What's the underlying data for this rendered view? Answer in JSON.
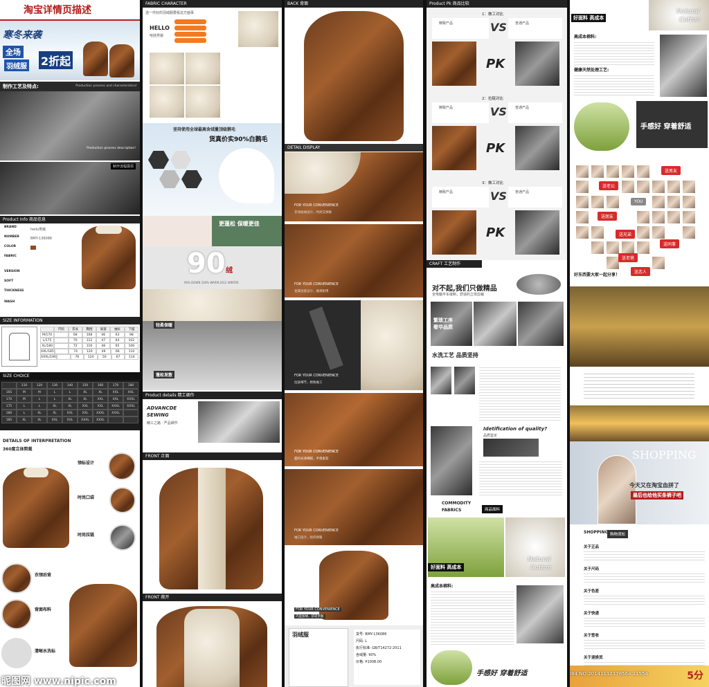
{
  "col1": {
    "header": "淘宝详情页描述",
    "banner_top": "寒冬来袭",
    "banner_mid": "全场",
    "banner_sub": "羽绒服",
    "banner_price": "2折起",
    "process_cn": "制作工艺及特点:",
    "process_en": "Production process and characteristics!",
    "process_note": "Production process description!",
    "flow_label": "制作流程展现",
    "product_info": "Product Info",
    "product_info_cn": "商品信息",
    "attr_brand": "BRAND",
    "attr_number": "NUMBER",
    "attr_color": "COLOR",
    "attr_fabric": "FABRIC",
    "attr_version": "VERSION",
    "attr_soft": "SOFT",
    "attr_thickness": "THICKNESS",
    "attr_wash": "WASH",
    "val_brand": "hello男装",
    "val_number": "BMY-136086",
    "size_info": "SIZE INFORMATION",
    "size_choice": "SIZE CHOICE",
    "size_headers": [
      "",
      "尺码",
      "衣长",
      "胸围",
      "肩宽",
      "袖长",
      "下摆"
    ],
    "size_rows": [
      [
        "M/170",
        "",
        "68",
        "108",
        "46",
        "63",
        "98"
      ],
      [
        "L/175",
        "",
        "70",
        "112",
        "47",
        "64",
        "102"
      ],
      [
        "XL/180",
        "",
        "72",
        "116",
        "48",
        "65",
        "106"
      ],
      [
        "XXL/185",
        "",
        "74",
        "120",
        "49",
        "66",
        "110"
      ],
      [
        "XXXL/190",
        "",
        "76",
        "124",
        "50",
        "67",
        "114"
      ]
    ],
    "choice_headers": [
      "",
      "110",
      "120",
      "130",
      "140",
      "150",
      "160",
      "170",
      "180"
    ],
    "choice_rows": [
      [
        "165",
        "M",
        "M",
        "L",
        "L",
        "XL",
        "XL",
        "XXL",
        "XXL"
      ],
      [
        "170",
        "M",
        "L",
        "L",
        "XL",
        "XL",
        "XXL",
        "XXL",
        "XXXL"
      ],
      [
        "175",
        "L",
        "L",
        "XL",
        "XL",
        "XXL",
        "XXL",
        "XXXL",
        "XXXL"
      ],
      [
        "180",
        "L",
        "XL",
        "XL",
        "XXL",
        "XXL",
        "XXXL",
        "XXXL",
        ""
      ],
      [
        "185",
        "XL",
        "XL",
        "XXL",
        "XXL",
        "XXXL",
        "XXXL",
        "",
        ""
      ]
    ],
    "details_en": "DETAILS OF INTERPRETATION",
    "details_cn": "360度立体剪裁",
    "detail_collar": "领标设计",
    "detail_pocket": "时尚口袋",
    "detail_zip": "时尚拉链",
    "detail_back": "衣领后背",
    "detail_fabric": "背面布料",
    "detail_wash": "清晰水洗标",
    "watermark": "昵图网 www.nipic.com"
  },
  "col2": {
    "fabric_bar": "FABRIC CHARACTER",
    "fabric_cn": "选一件好的羽绒服要看这方面事",
    "hello": "HELLO",
    "hello_sub": "哈娃男装",
    "goose_title": "坚持使用全球最高含绒量顶级鹅毛",
    "goose_sub": "货真价实90%白鹅毛",
    "fluffy": "更蓬松 保暖更佳",
    "ninety": "90",
    "ninety_cn": "绒",
    "ninety_en": "90% DOWN   100% WARM   2012 WINTER",
    "light": "轻柔保暖",
    "fluff_warm": "蓬松发散",
    "details_bar": "Product details",
    "details_cn": "精工细作",
    "advance": "ADVANCDE",
    "sewing": "SEWING",
    "sewing_cn": "精工之路 · 严品细节",
    "front_bar": "FRONT",
    "front_cn": "正面",
    "front2_bar": "FRONT",
    "front2_cn": "敞开"
  },
  "col3": {
    "back_bar": "BACK",
    "back_cn": "背面",
    "detail_bar": "DETAIL DISPLAY",
    "conv": "FOR YOUR CONVENIENCE",
    "conv2": "FOR YOUR CONVENIENCE",
    "cap1": "衣领加绒设计，时尚又保暖",
    "cap2": "金属拉链设计，顺滑耐用",
    "cap3": "拉链细节，精致做工",
    "cap4": "面料光泽细腻，手感柔软",
    "cap5": "袖口设计，防风保暖",
    "cap6": "内里加绒，舒适亲肤",
    "label_title": "羽绒服",
    "label_lines": [
      "货号: BMY-136086",
      "尺码: L",
      "执行标准: GB/T14272-2011",
      "含绒量: 90%",
      "价格: ¥1008.00"
    ]
  },
  "col4": {
    "pk_bar": "Product Pk",
    "pk_cn": "商品比较",
    "cmp1": "1：做工对比",
    "cmp2": "2：拉链对比",
    "cmp3": "3：做工对比",
    "ours": "精致产品",
    "others": "普通产品",
    "vs": "VS",
    "pk": "PK",
    "craft_bar": "CRAFT",
    "craft_sub": "MANUFACTURE",
    "craft_cn": "工艺制作",
    "sorry": "对不起,我们只做精品",
    "sorry_sub": "全电脑平车缝制，舒适的立体剪裁",
    "boutique": "繁琐工序\n奢华品质",
    "wash": "水洗工艺 品质坚持",
    "ident": "Idetification of quality?",
    "ident_cn": "品质鉴定",
    "commodity": "COMMODITY",
    "fabrics": "FABRICS",
    "fabrics_cn": "商品面料",
    "good_fabric": "好面料 高成本",
    "natural": "Natural",
    "cotton": "Cotton",
    "cost_label": "高成本棉料:",
    "feel": "手感好 穿着舒适"
  },
  "col5": {
    "good_fabric": "好面料 高成本",
    "natural": "Natural",
    "cotton": "Cotton",
    "cost_label": "高成本棉料:",
    "process_label": "健康天然处理工艺:",
    "feel": "手感好 穿着舒适",
    "gift_bf": "送男友",
    "gift_dad": "送老公",
    "gift_friend": "送朋友",
    "gift_you": "YOU",
    "gift_brother": "送兄弟",
    "gift_colleague": "送同事",
    "gift_father": "送老爸",
    "gift_lover": "送恋人",
    "share": "好东西要大家一起分享！",
    "shopping": "SHOPPING",
    "shopping_title": "今天又在淘宝血拼了",
    "shopping_sub": "最后也给他买条裤子吧",
    "shopping_info": "SHOPPING INFO.",
    "shopping_info_cn": "购物须知",
    "info_items": [
      "关于正品",
      "关于尺码",
      "关于色差",
      "关于快递",
      "关于签收",
      "关于退换货"
    ],
    "promo": "5分",
    "watermark_id": "ID:9504084 NO:20141112178564 11554"
  },
  "colors": {
    "brown": "#8b4e25",
    "dark": "#222222",
    "red": "#b51d1d",
    "accent_green": "#4d7b2a"
  }
}
